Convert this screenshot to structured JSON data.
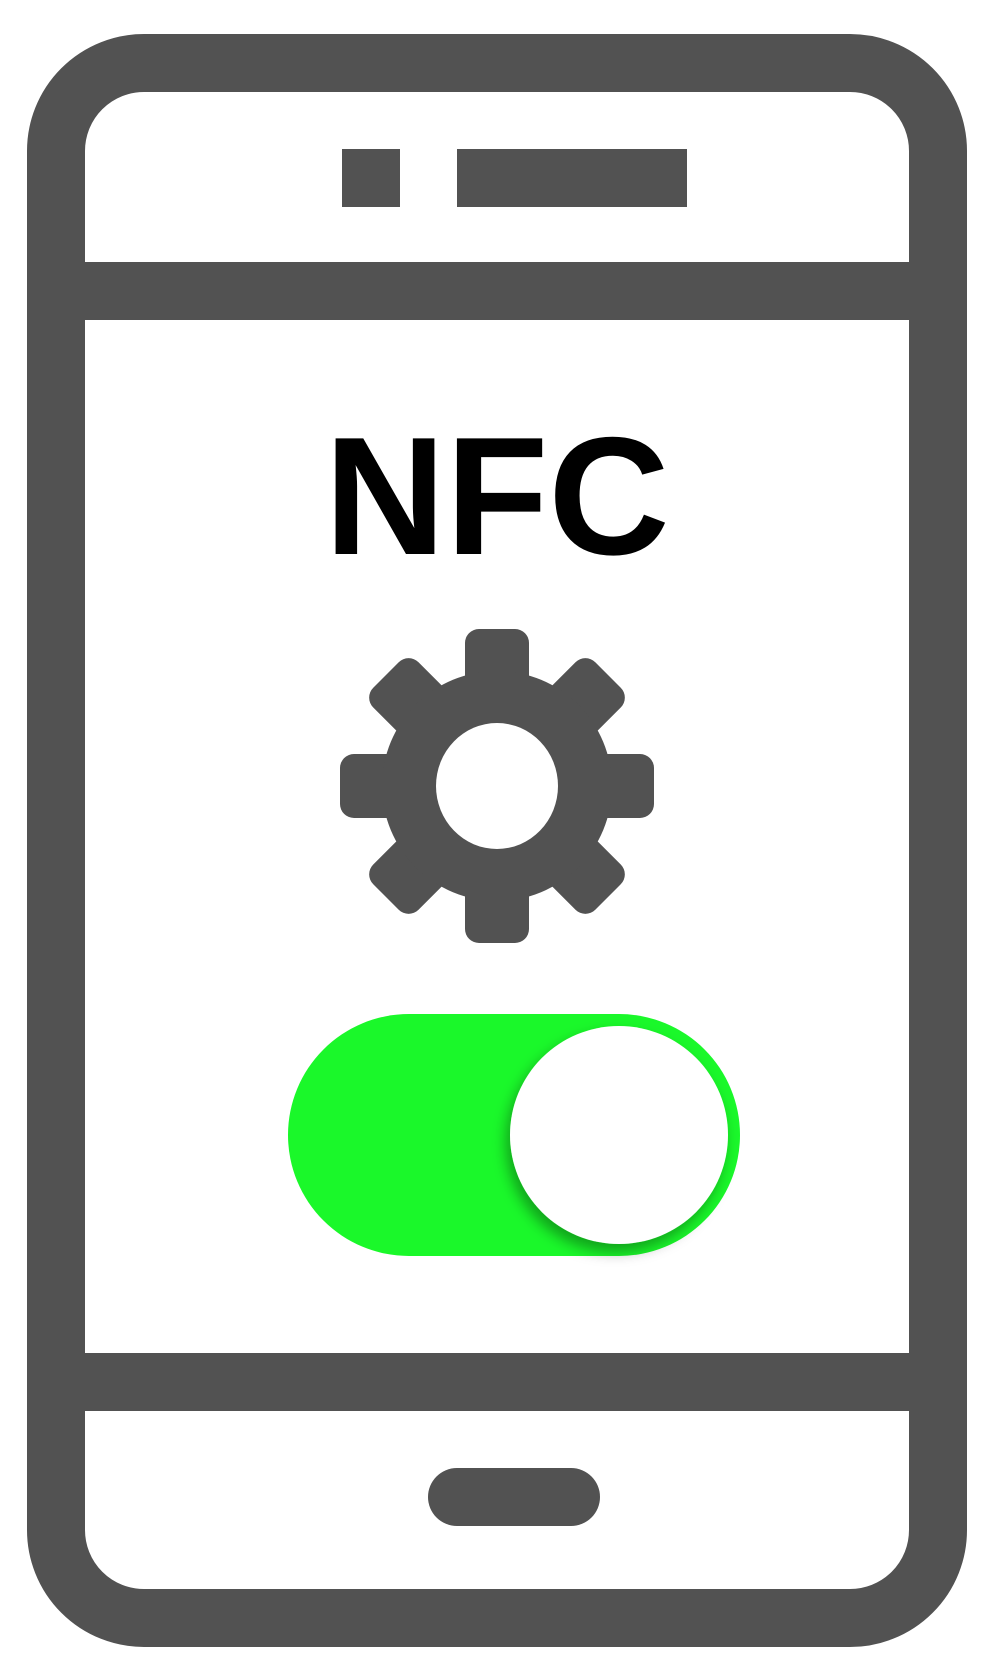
{
  "screen": {
    "title": "NFC"
  },
  "settings_icon": {
    "icon": "gear-icon"
  },
  "nfc_toggle": {
    "state": "on"
  },
  "colors": {
    "device_frame": "#525252",
    "title": "#000000",
    "toggle_on": "#1af82a",
    "toggle_knob": "#ffffff",
    "background": "#ffffff"
  }
}
